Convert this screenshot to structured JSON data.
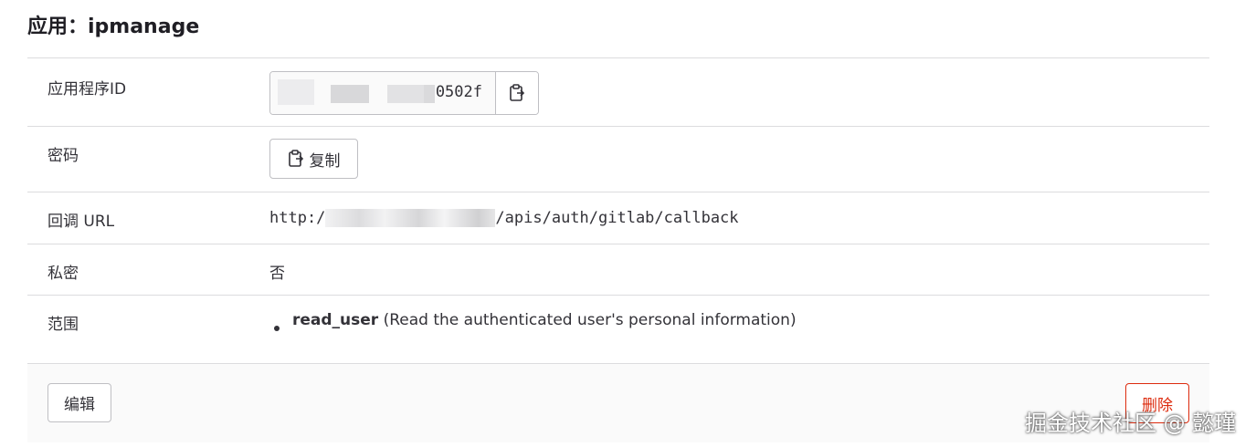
{
  "page": {
    "title": "应用：ipmanage"
  },
  "fields": {
    "app_id": {
      "label": "应用程序ID",
      "value_visible": "0502f"
    },
    "secret": {
      "label": "密码",
      "copy_label": "复制"
    },
    "callback": {
      "label": "回调 URL",
      "prefix": "http:/",
      "suffix": "/apis/auth/gitlab/callback"
    },
    "private": {
      "label": "私密",
      "value": "否"
    },
    "scopes": {
      "label": "范围",
      "items": [
        {
          "name": "read_user",
          "description": "(Read the authenticated user's personal information)"
        }
      ]
    }
  },
  "footer": {
    "edit_label": "编辑",
    "delete_label": "删除"
  },
  "watermark": {
    "text": "掘金技术社区 @ 懿瑾"
  },
  "colors": {
    "danger": "#dd2b0e",
    "border": "#dcdcde"
  },
  "icons": {
    "copy": "clipboard-icon"
  }
}
